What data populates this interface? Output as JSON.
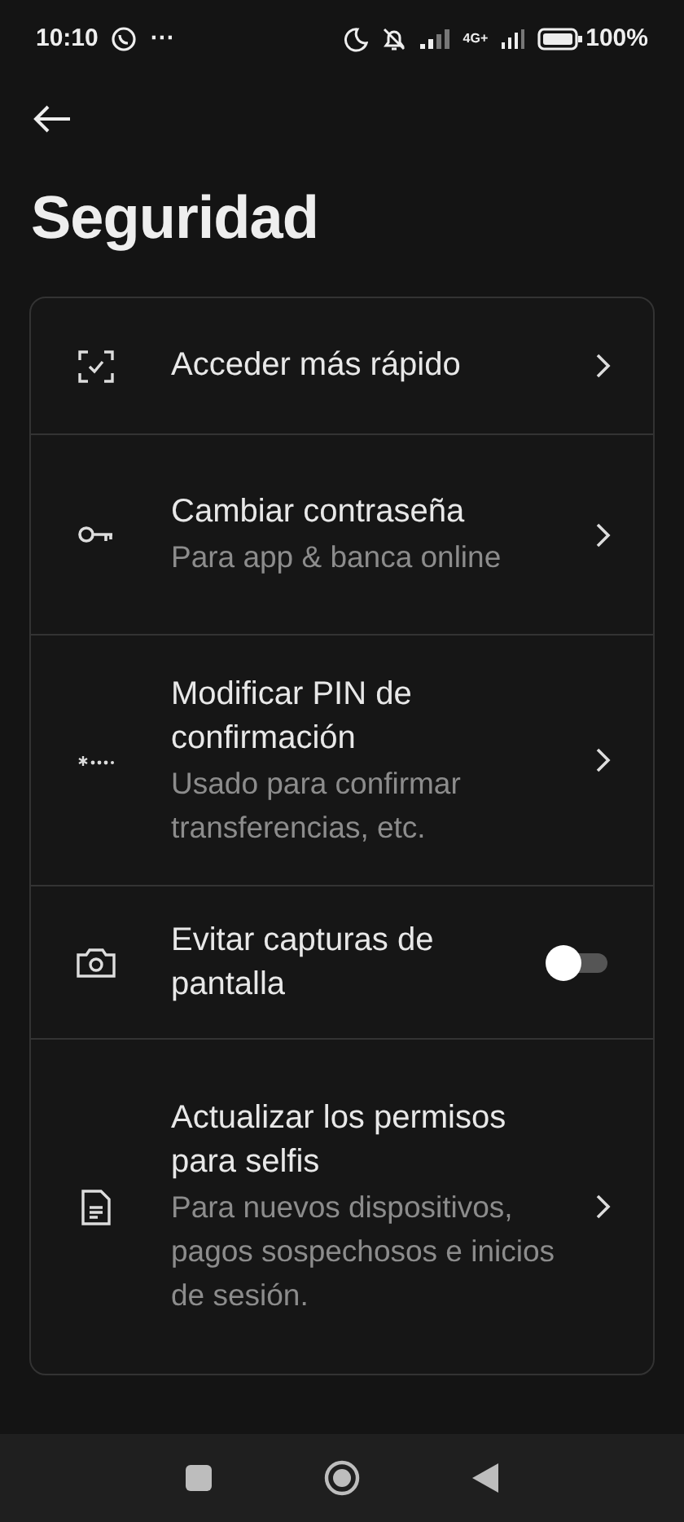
{
  "status_bar": {
    "time": "10:10",
    "more": "···",
    "network": "4G+",
    "battery": "100%"
  },
  "title": "Seguridad",
  "items": [
    {
      "kind": "link",
      "title": "Acceder más rápido"
    },
    {
      "kind": "link",
      "title": "Cambiar contraseña",
      "subtitle": "Para app & banca online"
    },
    {
      "kind": "link",
      "title": "Modificar PIN de confirmación",
      "subtitle": "Usado para confirmar transferencias, etc."
    },
    {
      "kind": "toggle",
      "title": "Evitar capturas de pantalla",
      "on": false
    },
    {
      "kind": "link",
      "title": "Actualizar los permisos para selfis",
      "subtitle": "Para nuevos dispositivos, pagos sospechosos e inicios de sesión."
    }
  ]
}
